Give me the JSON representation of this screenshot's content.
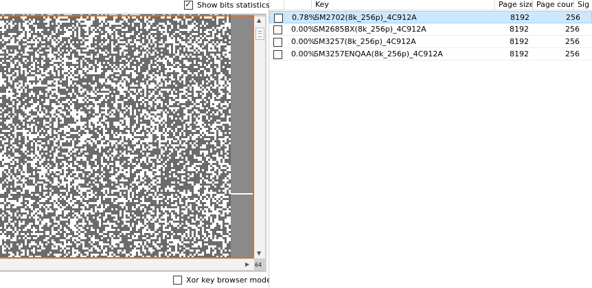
{
  "bits_panel": {
    "show_bits_statistics_label": "Show bits statistics",
    "show_bits_statistics_checked": true,
    "xor_key_browser_mode_label": "Xor key browser mode",
    "xor_key_browser_mode_checked": false,
    "page_number": "64"
  },
  "key_list": {
    "columns": [
      "",
      "",
      "Key",
      "Page size",
      "Page count",
      "Sig"
    ],
    "rows": [
      {
        "selected": true,
        "checked": false,
        "match": "0.78%",
        "key": "SM2702(8k_256p)_4C912A",
        "page_size": "8192",
        "page_count": "256"
      },
      {
        "selected": false,
        "checked": false,
        "match": "0.00%",
        "key": "SM2685BX(8k_256p)_4C912A",
        "page_size": "8192",
        "page_count": "256"
      },
      {
        "selected": false,
        "checked": false,
        "match": "0.00%",
        "key": "SM3257(8k_256p)_4C912A",
        "page_size": "8192",
        "page_count": "256"
      },
      {
        "selected": false,
        "checked": false,
        "match": "0.00%",
        "key": "SM3257ENQAA(8k_256p)_4C912A",
        "page_size": "8192",
        "page_count": "256"
      }
    ]
  },
  "colors": {
    "bit_set": "#6b6b6b",
    "bit_clear": "#ffffff",
    "accent_border": "#e86a1a",
    "selection": "#cce8ff"
  }
}
